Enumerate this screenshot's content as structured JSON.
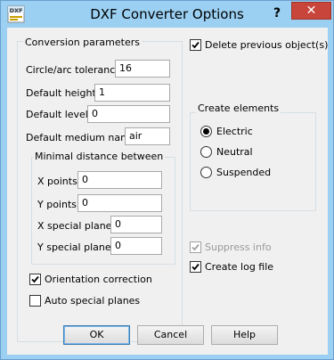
{
  "window": {
    "title": "DXF Converter Options",
    "icon_label": "DXF",
    "help_glyph": "?",
    "close_glyph": "✕"
  },
  "conversion": {
    "group_title": "Conversion parameters",
    "circle_arc_tolerance": {
      "label": "Circle/arc tolerance",
      "value": "16"
    },
    "default_height": {
      "label": "Default height",
      "value": "1"
    },
    "default_level": {
      "label": "Default level",
      "value": "0"
    },
    "default_medium_name": {
      "label": "Default medium name",
      "value": "air"
    },
    "minimal_distance": {
      "group_title": "Minimal distance between",
      "x_points": {
        "label": "X points",
        "value": "0"
      },
      "y_points": {
        "label": "Y points",
        "value": "0"
      },
      "x_special_planes": {
        "label": "X special planes",
        "value": "0"
      },
      "y_special_planes": {
        "label": "Y special planes",
        "value": "0"
      }
    },
    "orientation_correction": {
      "label": "Orientation correction",
      "checked": true
    },
    "auto_special_planes": {
      "label": "Auto special planes",
      "checked": false
    }
  },
  "delete_previous": {
    "label": "Delete previous object(s)",
    "checked": true
  },
  "create_elements": {
    "group_title": "Create elements",
    "options": [
      {
        "label": "Electric",
        "selected": true
      },
      {
        "label": "Neutral",
        "selected": false
      },
      {
        "label": "Suspended",
        "selected": false
      }
    ]
  },
  "suppress_info": {
    "label": "Suppress info",
    "checked": true,
    "disabled": true
  },
  "create_log_file": {
    "label": "Create log file",
    "checked": true
  },
  "buttons": {
    "ok": "OK",
    "cancel": "Cancel",
    "help": "Help"
  },
  "colors": {
    "title_bar": "#9bd0f3",
    "close_button": "#c7453a",
    "dialog_background": "#f0f0f0",
    "disabled_text": "#9a9a9a"
  }
}
